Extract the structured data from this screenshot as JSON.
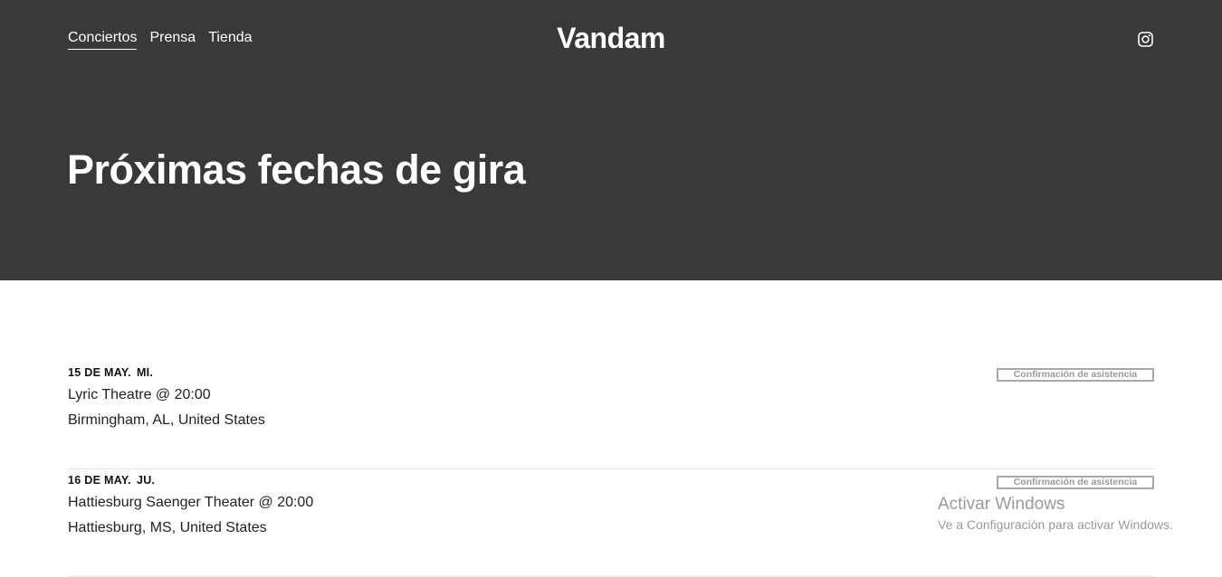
{
  "header": {
    "nav": [
      "Conciertos",
      "Prensa",
      "Tienda"
    ],
    "brand": "Vandam",
    "social_icon": "instagram-icon"
  },
  "hero": {
    "title": "Próximas fechas de gira"
  },
  "events": [
    {
      "date": "15 DE MAY.",
      "weekday": "MI.",
      "venue": "Lyric Theatre @ 20:00",
      "location": "Birmingham, AL, United States",
      "rsvp_label": "Confirmación de asistencia"
    },
    {
      "date": "16 DE MAY.",
      "weekday": "JU.",
      "venue": "Hattiesburg Saenger Theater @ 20:00",
      "location": "Hattiesburg, MS, United States",
      "rsvp_label": "Confirmación de asistencia"
    }
  ],
  "watermark": {
    "title": "Activar Windows",
    "subtitle": "Ve a Configuración para activar Windows."
  },
  "colors": {
    "hero_bg": "#39393b",
    "text_light": "#ffffff",
    "button_border": "#a8a8a8"
  }
}
